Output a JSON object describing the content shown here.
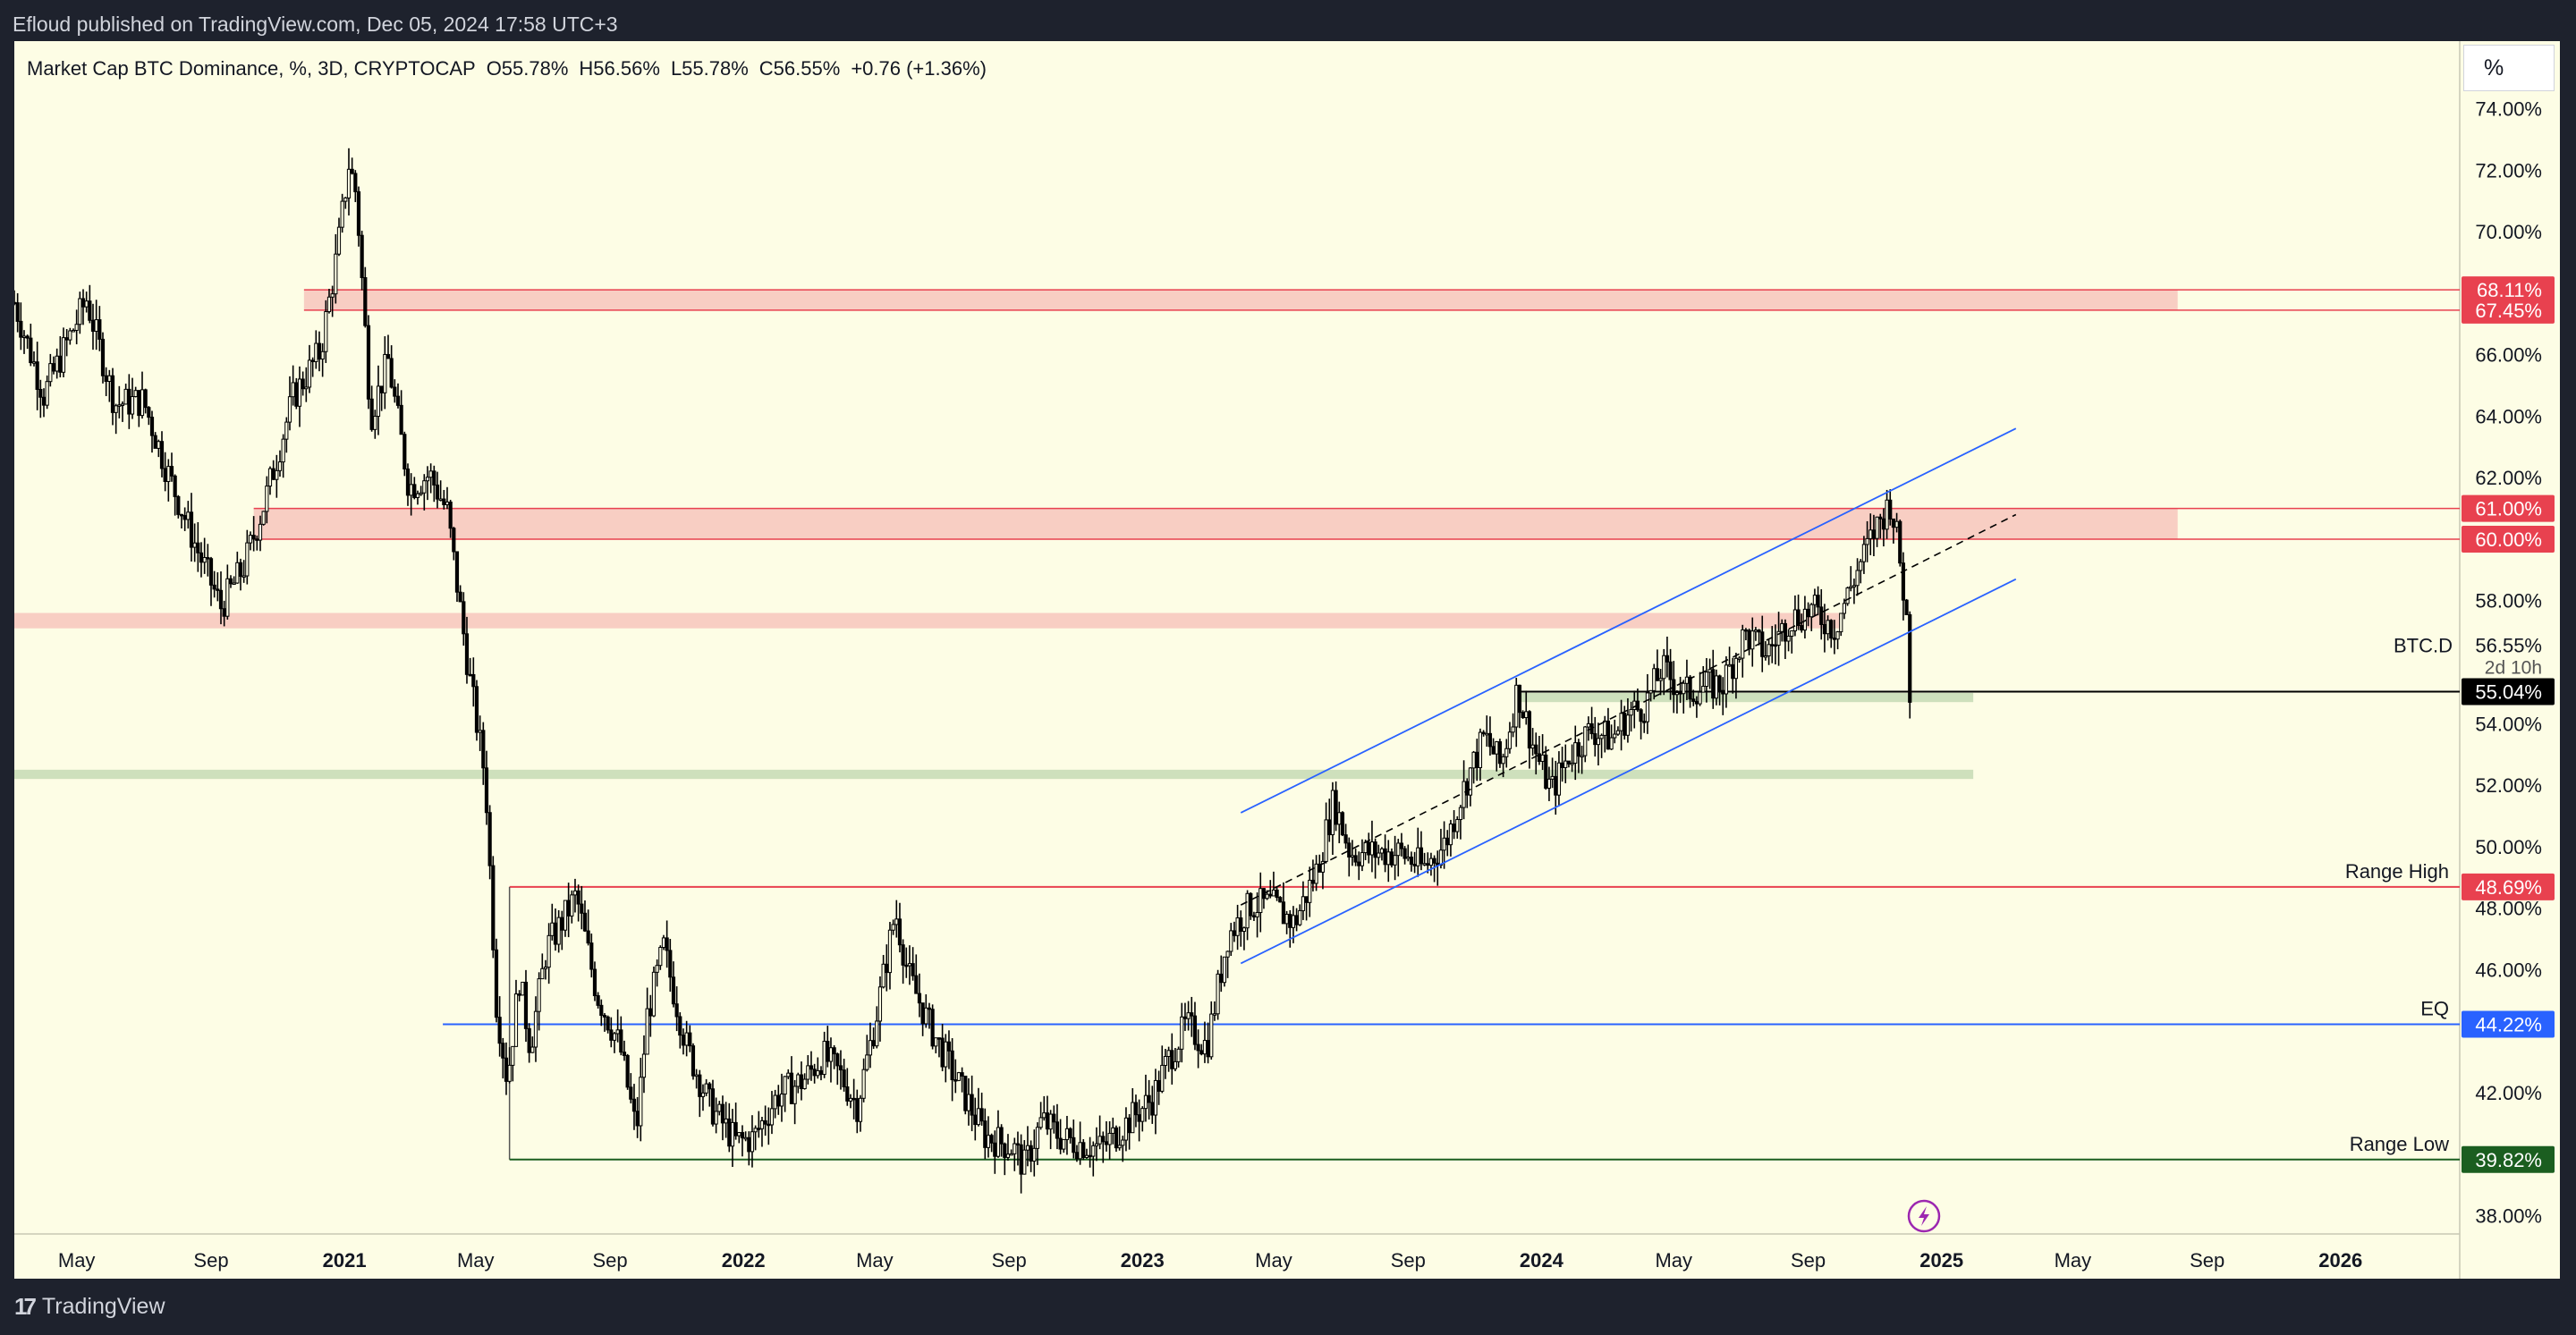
{
  "header": {
    "published": "Efloud published on TradingView.com, Dec 05, 2024 17:58 UTC+3"
  },
  "legend": {
    "symbol": "Market Cap BTC Dominance, %, 3D, CRYPTOCAP",
    "open": "O55.78%",
    "high": "H56.56%",
    "low": "L55.78%",
    "close": "C56.55%",
    "change": "+0.76 (+1.36%)"
  },
  "scale_unit": "%",
  "footer": {
    "brand": "TradingView"
  },
  "colors": {
    "candle": "#000000",
    "resistance_zone": "#f7c5bd",
    "support_zone": "#c9ddb7",
    "red_line": "#e8414f",
    "channel": "#2962ff",
    "green_label": "#1b5e20",
    "background": "#fdfde5"
  },
  "chart_data": {
    "type": "candlestick",
    "title": "Market Cap BTC Dominance",
    "ylabel": "%",
    "ylim": [
      37.4,
      76.2
    ],
    "xlim": [
      "2020-03-05",
      "2026-04-20"
    ],
    "y_ticks": [
      "74.00%",
      "72.00%",
      "70.00%",
      "66.00%",
      "64.00%",
      "62.00%",
      "58.00%",
      "54.00%",
      "52.00%",
      "50.00%",
      "48.00%",
      "46.00%",
      "42.00%",
      "38.00%"
    ],
    "y_tick_values": [
      74,
      72,
      70,
      66,
      64,
      62,
      58,
      54,
      52,
      50,
      48,
      46,
      42,
      38
    ],
    "x_ticks": [
      {
        "label": "May",
        "date": "2020-05-01",
        "bold": false
      },
      {
        "label": "Sep",
        "date": "2020-09-01",
        "bold": false
      },
      {
        "label": "2021",
        "date": "2021-01-01",
        "bold": true
      },
      {
        "label": "May",
        "date": "2021-05-01",
        "bold": false
      },
      {
        "label": "Sep",
        "date": "2021-09-01",
        "bold": false
      },
      {
        "label": "2022",
        "date": "2022-01-01",
        "bold": true
      },
      {
        "label": "May",
        "date": "2022-05-01",
        "bold": false
      },
      {
        "label": "Sep",
        "date": "2022-09-01",
        "bold": false
      },
      {
        "label": "2023",
        "date": "2023-01-01",
        "bold": true
      },
      {
        "label": "May",
        "date": "2023-05-01",
        "bold": false
      },
      {
        "label": "Sep",
        "date": "2023-09-01",
        "bold": false
      },
      {
        "label": "2024",
        "date": "2024-01-01",
        "bold": true
      },
      {
        "label": "May",
        "date": "2024-05-01",
        "bold": false
      },
      {
        "label": "Sep",
        "date": "2024-09-01",
        "bold": false
      },
      {
        "label": "2025",
        "date": "2025-01-01",
        "bold": true
      },
      {
        "label": "May",
        "date": "2025-05-01",
        "bold": false
      },
      {
        "label": "Sep",
        "date": "2025-09-01",
        "bold": false
      },
      {
        "label": "2026",
        "date": "2026-01-01",
        "bold": true
      }
    ],
    "price_path": [
      [
        "2020-03-05",
        67.7
      ],
      [
        "2020-04-01",
        64.7
      ],
      [
        "2020-05-10",
        67.8
      ],
      [
        "2020-06-05",
        64.4
      ],
      [
        "2020-07-01",
        64.5
      ],
      [
        "2020-07-25",
        62.0
      ],
      [
        "2020-08-20",
        59.6
      ],
      [
        "2020-09-10",
        57.8
      ],
      [
        "2020-10-01",
        59.1
      ],
      [
        "2020-10-20",
        61.2
      ],
      [
        "2020-11-15",
        64.6
      ],
      [
        "2020-12-10",
        66.1
      ],
      [
        "2020-12-25",
        69.2
      ],
      [
        "2021-01-05",
        72.2
      ],
      [
        "2021-01-12",
        71.2
      ],
      [
        "2021-01-25",
        64.0
      ],
      [
        "2021-02-10",
        65.8
      ],
      [
        "2021-03-01",
        61.7
      ],
      [
        "2021-03-20",
        62.1
      ],
      [
        "2021-04-05",
        60.9
      ],
      [
        "2021-04-25",
        55.6
      ],
      [
        "2021-05-10",
        52.2
      ],
      [
        "2021-05-20",
        44.9
      ],
      [
        "2021-05-30",
        42.4
      ],
      [
        "2021-06-10",
        45.7
      ],
      [
        "2021-06-20",
        43.5
      ],
      [
        "2021-07-05",
        46.7
      ],
      [
        "2021-07-15",
        47.3
      ],
      [
        "2021-08-01",
        48.4
      ],
      [
        "2021-08-20",
        45.2
      ],
      [
        "2021-09-10",
        43.5
      ],
      [
        "2021-09-25",
        40.7
      ],
      [
        "2021-10-05",
        44.5
      ],
      [
        "2021-10-20",
        46.7
      ],
      [
        "2021-11-10",
        43.5
      ],
      [
        "2021-12-01",
        41.6
      ],
      [
        "2021-12-25",
        40.4
      ],
      [
        "2022-01-10",
        40.5
      ],
      [
        "2022-02-01",
        41.9
      ],
      [
        "2022-02-25",
        42.4
      ],
      [
        "2022-03-15",
        43.2
      ],
      [
        "2022-03-30",
        42.6
      ],
      [
        "2022-04-15",
        41.6
      ],
      [
        "2022-05-01",
        44.2
      ],
      [
        "2022-05-20",
        47.9
      ],
      [
        "2022-06-01",
        45.8
      ],
      [
        "2022-06-20",
        44.2
      ],
      [
        "2022-07-15",
        42.4
      ],
      [
        "2022-08-10",
        40.6
      ],
      [
        "2022-09-05",
        40.2
      ],
      [
        "2022-09-15",
        39.6
      ],
      [
        "2022-10-01",
        41.1
      ],
      [
        "2022-10-20",
        40.5
      ],
      [
        "2022-11-10",
        40.3
      ],
      [
        "2022-11-25",
        40.2
      ],
      [
        "2022-12-20",
        41.1
      ],
      [
        "2023-01-10",
        41.8
      ],
      [
        "2023-01-25",
        43.1
      ],
      [
        "2023-02-10",
        44.2
      ],
      [
        "2023-03-01",
        43.5
      ],
      [
        "2023-03-20",
        47.1
      ],
      [
        "2023-04-10",
        48.1
      ],
      [
        "2023-04-30",
        48.1
      ],
      [
        "2023-05-20",
        47.5
      ],
      [
        "2023-06-10",
        49.3
      ],
      [
        "2023-06-25",
        51.5
      ],
      [
        "2023-07-10",
        49.8
      ],
      [
        "2023-08-01",
        49.8
      ],
      [
        "2023-08-25",
        49.8
      ],
      [
        "2023-09-15",
        49.3
      ],
      [
        "2023-10-05",
        50.1
      ],
      [
        "2023-10-25",
        52.2
      ],
      [
        "2023-11-10",
        53.6
      ],
      [
        "2023-11-25",
        52.6
      ],
      [
        "2023-12-10",
        55.1
      ],
      [
        "2023-12-25",
        53.2
      ],
      [
        "2024-01-10",
        51.8
      ],
      [
        "2024-01-25",
        52.9
      ],
      [
        "2024-02-15",
        53.8
      ],
      [
        "2024-03-05",
        53.5
      ],
      [
        "2024-03-20",
        54.3
      ],
      [
        "2024-04-05",
        54.6
      ],
      [
        "2024-04-20",
        55.8
      ],
      [
        "2024-05-10",
        55.0
      ],
      [
        "2024-05-30",
        55.2
      ],
      [
        "2024-06-15",
        55.3
      ],
      [
        "2024-07-05",
        56.9
      ],
      [
        "2024-07-25",
        56.3
      ],
      [
        "2024-08-15",
        57.4
      ],
      [
        "2024-09-05",
        57.7
      ],
      [
        "2024-09-25",
        57.1
      ],
      [
        "2024-10-15",
        58.9
      ],
      [
        "2024-11-01",
        60.3
      ],
      [
        "2024-11-15",
        61.2
      ],
      [
        "2024-11-22",
        59.9
      ],
      [
        "2024-11-30",
        57.4
      ],
      [
        "2024-12-03",
        55.1
      ],
      [
        "2024-12-05",
        56.55
      ]
    ],
    "zones": [
      {
        "type": "resistance",
        "from": 67.45,
        "to": 68.11,
        "start": "2020-11-25",
        "end": "2025-08-05"
      },
      {
        "type": "resistance",
        "from": 60.0,
        "to": 61.0,
        "start": "2020-10-10",
        "end": "2025-08-05"
      },
      {
        "type": "resistance",
        "from": 57.1,
        "to": 57.6,
        "start": "2020-03-05",
        "end": "2024-09-30"
      },
      {
        "type": "support",
        "from": 54.7,
        "to": 55.0,
        "start": "2023-12-10",
        "end": "2025-01-30"
      },
      {
        "type": "support",
        "from": 52.2,
        "to": 52.5,
        "start": "2020-03-05",
        "end": "2025-01-30"
      }
    ],
    "levels": [
      {
        "value": 48.69,
        "label": "Range High",
        "price_tag": "48.69%",
        "color": "#e8414f",
        "start": "2021-06-01"
      },
      {
        "value": 44.22,
        "label": "EQ",
        "price_tag": "44.22%",
        "color": "#2962ff",
        "start": "2021-04-01"
      },
      {
        "value": 39.82,
        "label": "Range Low",
        "price_tag": "39.82%",
        "color": "#1b5e20",
        "start": "2021-06-01"
      },
      {
        "value": 55.04,
        "label": "",
        "price_tag": "55.04%",
        "color": "#000000",
        "start": "2023-12-10"
      }
    ],
    "price_tags": [
      {
        "value": 68.11,
        "text": "68.11%",
        "color": "#e8414f"
      },
      {
        "value": 67.45,
        "text": "67.45%",
        "color": "#e8414f"
      },
      {
        "value": 61.0,
        "text": "61.00%",
        "color": "#e8414f"
      },
      {
        "value": 60.0,
        "text": "60.00%",
        "color": "#e8414f"
      }
    ],
    "channel": {
      "upper": [
        [
          "2023-04-01",
          51.1
        ],
        [
          "2025-03-10",
          63.6
        ]
      ],
      "mid": [
        [
          "2023-04-01",
          48.1
        ],
        [
          "2025-03-10",
          60.8
        ]
      ],
      "lower": [
        [
          "2023-04-01",
          46.2
        ],
        [
          "2025-03-10",
          58.7
        ]
      ]
    },
    "current": {
      "label": "BTC.D",
      "value": 56.55,
      "text": "56.55%",
      "countdown": "2d 10h"
    }
  }
}
